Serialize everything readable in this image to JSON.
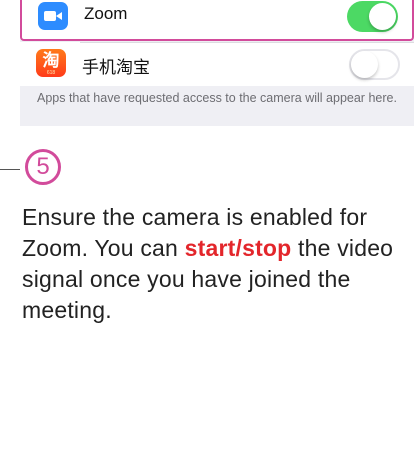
{
  "settings": {
    "apps": [
      {
        "name": "Zoom",
        "icon": "video-camera-icon",
        "enabled": true
      },
      {
        "name": "手机淘宝",
        "icon": "taobao-icon",
        "icon_glyph": "淘",
        "icon_tag": "618",
        "enabled": false
      }
    ],
    "footer_note": "Apps that have requested access to the camera will appear here."
  },
  "step": {
    "number": "5",
    "text_before": "Ensure the camera is enabled for Zoom. You can ",
    "highlight": "start/stop",
    "text_after": " the video signal once you have joined the meeting."
  },
  "colors": {
    "accent": "#d24b9b",
    "highlight": "#e3262b",
    "toggle_on": "#4cd964",
    "zoom_blue": "#2d8cff"
  }
}
